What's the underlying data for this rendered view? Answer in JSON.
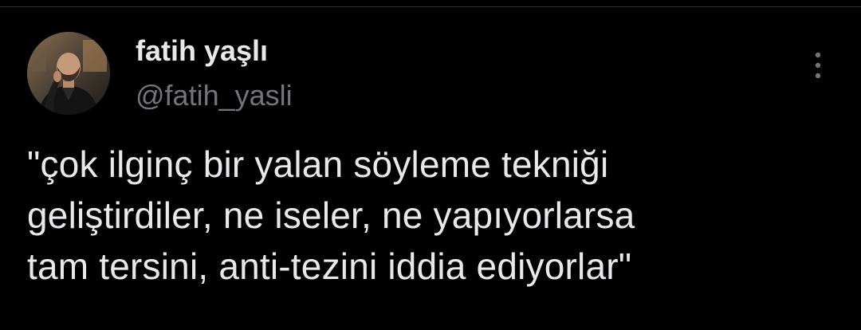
{
  "tweet": {
    "author": {
      "display_name": "fatih yaşlı",
      "handle": "@fatih_yasli",
      "avatar_icon": "profile-photo-avatar"
    },
    "more_icon": "more-vertical-icon",
    "text": "\"çok ilginç bir yalan söyleme tekniği\ngeliştirdiler, ne iseler, ne yapıyorlarsa\ntam tersini, anti-tezini iddia ediyorlar\""
  },
  "colors": {
    "background": "#000000",
    "primary_text": "#e7e9ea",
    "secondary_text": "#71767b",
    "divider": "#2f3336"
  }
}
